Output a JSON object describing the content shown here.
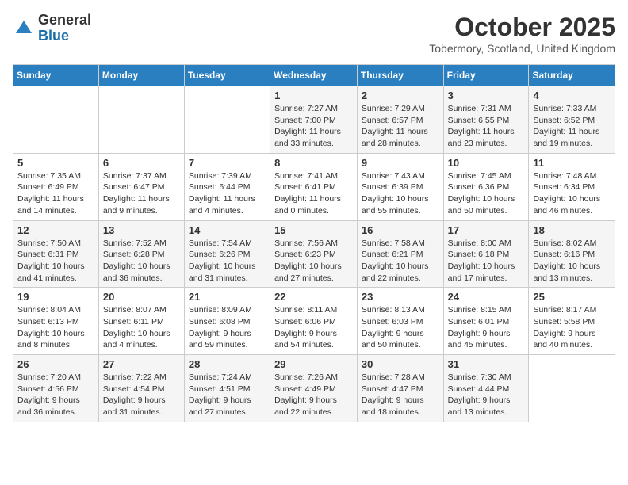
{
  "header": {
    "logo_general": "General",
    "logo_blue": "Blue",
    "month": "October 2025",
    "location": "Tobermory, Scotland, United Kingdom"
  },
  "days_of_week": [
    "Sunday",
    "Monday",
    "Tuesday",
    "Wednesday",
    "Thursday",
    "Friday",
    "Saturday"
  ],
  "weeks": [
    [
      {
        "day": "",
        "info": ""
      },
      {
        "day": "",
        "info": ""
      },
      {
        "day": "",
        "info": ""
      },
      {
        "day": "1",
        "info": "Sunrise: 7:27 AM\nSunset: 7:00 PM\nDaylight: 11 hours\nand 33 minutes."
      },
      {
        "day": "2",
        "info": "Sunrise: 7:29 AM\nSunset: 6:57 PM\nDaylight: 11 hours\nand 28 minutes."
      },
      {
        "day": "3",
        "info": "Sunrise: 7:31 AM\nSunset: 6:55 PM\nDaylight: 11 hours\nand 23 minutes."
      },
      {
        "day": "4",
        "info": "Sunrise: 7:33 AM\nSunset: 6:52 PM\nDaylight: 11 hours\nand 19 minutes."
      }
    ],
    [
      {
        "day": "5",
        "info": "Sunrise: 7:35 AM\nSunset: 6:49 PM\nDaylight: 11 hours\nand 14 minutes."
      },
      {
        "day": "6",
        "info": "Sunrise: 7:37 AM\nSunset: 6:47 PM\nDaylight: 11 hours\nand 9 minutes."
      },
      {
        "day": "7",
        "info": "Sunrise: 7:39 AM\nSunset: 6:44 PM\nDaylight: 11 hours\nand 4 minutes."
      },
      {
        "day": "8",
        "info": "Sunrise: 7:41 AM\nSunset: 6:41 PM\nDaylight: 11 hours\nand 0 minutes."
      },
      {
        "day": "9",
        "info": "Sunrise: 7:43 AM\nSunset: 6:39 PM\nDaylight: 10 hours\nand 55 minutes."
      },
      {
        "day": "10",
        "info": "Sunrise: 7:45 AM\nSunset: 6:36 PM\nDaylight: 10 hours\nand 50 minutes."
      },
      {
        "day": "11",
        "info": "Sunrise: 7:48 AM\nSunset: 6:34 PM\nDaylight: 10 hours\nand 46 minutes."
      }
    ],
    [
      {
        "day": "12",
        "info": "Sunrise: 7:50 AM\nSunset: 6:31 PM\nDaylight: 10 hours\nand 41 minutes."
      },
      {
        "day": "13",
        "info": "Sunrise: 7:52 AM\nSunset: 6:28 PM\nDaylight: 10 hours\nand 36 minutes."
      },
      {
        "day": "14",
        "info": "Sunrise: 7:54 AM\nSunset: 6:26 PM\nDaylight: 10 hours\nand 31 minutes."
      },
      {
        "day": "15",
        "info": "Sunrise: 7:56 AM\nSunset: 6:23 PM\nDaylight: 10 hours\nand 27 minutes."
      },
      {
        "day": "16",
        "info": "Sunrise: 7:58 AM\nSunset: 6:21 PM\nDaylight: 10 hours\nand 22 minutes."
      },
      {
        "day": "17",
        "info": "Sunrise: 8:00 AM\nSunset: 6:18 PM\nDaylight: 10 hours\nand 17 minutes."
      },
      {
        "day": "18",
        "info": "Sunrise: 8:02 AM\nSunset: 6:16 PM\nDaylight: 10 hours\nand 13 minutes."
      }
    ],
    [
      {
        "day": "19",
        "info": "Sunrise: 8:04 AM\nSunset: 6:13 PM\nDaylight: 10 hours\nand 8 minutes."
      },
      {
        "day": "20",
        "info": "Sunrise: 8:07 AM\nSunset: 6:11 PM\nDaylight: 10 hours\nand 4 minutes."
      },
      {
        "day": "21",
        "info": "Sunrise: 8:09 AM\nSunset: 6:08 PM\nDaylight: 9 hours\nand 59 minutes."
      },
      {
        "day": "22",
        "info": "Sunrise: 8:11 AM\nSunset: 6:06 PM\nDaylight: 9 hours\nand 54 minutes."
      },
      {
        "day": "23",
        "info": "Sunrise: 8:13 AM\nSunset: 6:03 PM\nDaylight: 9 hours\nand 50 minutes."
      },
      {
        "day": "24",
        "info": "Sunrise: 8:15 AM\nSunset: 6:01 PM\nDaylight: 9 hours\nand 45 minutes."
      },
      {
        "day": "25",
        "info": "Sunrise: 8:17 AM\nSunset: 5:58 PM\nDaylight: 9 hours\nand 40 minutes."
      }
    ],
    [
      {
        "day": "26",
        "info": "Sunrise: 7:20 AM\nSunset: 4:56 PM\nDaylight: 9 hours\nand 36 minutes."
      },
      {
        "day": "27",
        "info": "Sunrise: 7:22 AM\nSunset: 4:54 PM\nDaylight: 9 hours\nand 31 minutes."
      },
      {
        "day": "28",
        "info": "Sunrise: 7:24 AM\nSunset: 4:51 PM\nDaylight: 9 hours\nand 27 minutes."
      },
      {
        "day": "29",
        "info": "Sunrise: 7:26 AM\nSunset: 4:49 PM\nDaylight: 9 hours\nand 22 minutes."
      },
      {
        "day": "30",
        "info": "Sunrise: 7:28 AM\nSunset: 4:47 PM\nDaylight: 9 hours\nand 18 minutes."
      },
      {
        "day": "31",
        "info": "Sunrise: 7:30 AM\nSunset: 4:44 PM\nDaylight: 9 hours\nand 13 minutes."
      },
      {
        "day": "",
        "info": ""
      }
    ]
  ]
}
